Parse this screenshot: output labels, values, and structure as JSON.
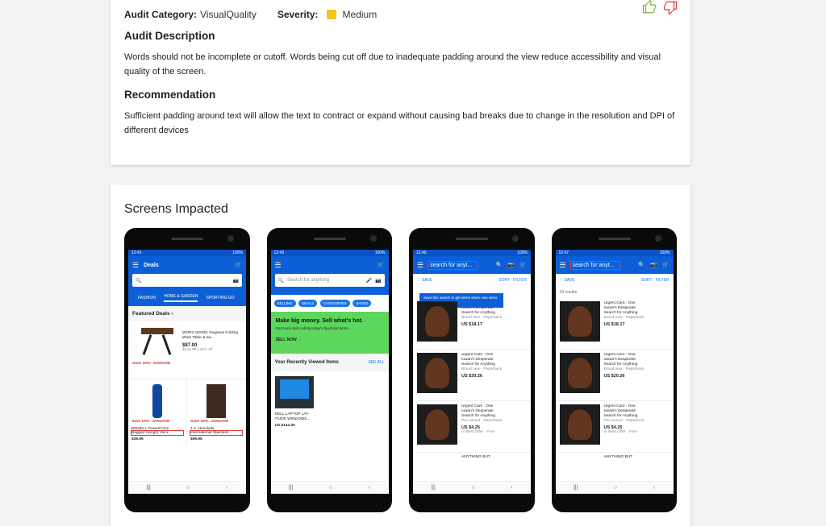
{
  "audit": {
    "category_label": "Audit Category:",
    "category_value": "VisualQuality",
    "severity_label": "Severity:",
    "severity_value": "Medium",
    "severity_color": "#f5c518",
    "description_heading": "Audit Description",
    "description_text": "Words should not be incomplete or cutoff. Words being cut off due to inadequate padding around the view reduce accessibility and visual quality of the screen.",
    "recommendation_heading": "Recommendation",
    "recommendation_text": "Sufficient padding around text will allow the text to contract or expand without causing bad breaks due to change in the resolution and DPI of different devices",
    "thumbs_up_color": "#7cb342",
    "thumbs_down_color": "#e53935"
  },
  "screens": {
    "heading": "Screens Impacted",
    "phone1": {
      "time": "12:41",
      "battery": "100%",
      "title": "Deals",
      "tabs": [
        "FASHION",
        "HOME & GARDEN",
        "SPORTING GO"
      ],
      "section": "Featured Deals",
      "item1_name": "WORX WX051 Pegasus Folding Work Table & Sa...",
      "item1_price": "$87.00",
      "item1_was": "$144.99 | 40% off",
      "item1_promo": "Save 15%: JANSAVE",
      "item2_promo": "Save 15%: JANSAVE",
      "item2_name1": "BISSELL PowerForce",
      "item2_name2": "Bagged Upright Vacu...",
      "item2_price": "$39.99",
      "item3_promo": "Save 15%: JANSAVE",
      "item3_name1": "J.A. Henckels",
      "item3_name2": "International Stainless...",
      "item3_price": "$99.95"
    },
    "phone2": {
      "time": "12:43",
      "battery": "100%",
      "search_placeholder": "Search for anything",
      "chips": [
        "SELLING",
        "DEALS",
        "CATEGORIES",
        "SAVED"
      ],
      "banner_heading": "Make big money. Sell what's hot.",
      "banner_sub": "Get more cash selling today's big-ticket items.",
      "banner_cta": "SELL NOW",
      "recent_heading": "Your Recently Viewed Items",
      "see_all": "SEE ALL",
      "item_name": "DELL LAPTOP LAT-ITUDE WINDOWS...",
      "item_price": "US $142.00"
    },
    "phone3": {
      "time": "12:46",
      "battery": "100%",
      "search_text": "search for anyt...",
      "save": "SAVE",
      "sort": "SORT",
      "filter": "FILTER",
      "tooltip": "Save this search to get alerts when new items arrive",
      "items": [
        {
          "l1": "Urgent Care : One",
          "l2": "Iowan's Desperate",
          "l3": "Search for Anything",
          "sub": "Brand new · Paperback",
          "price": "US $18.17",
          "extra": ""
        },
        {
          "l1": "Urgent Care : One",
          "l2": "Iowan's Desperate",
          "l3": "Search for Anything",
          "sub": "Brand new · Paperback",
          "price": "US $20.26",
          "extra": ""
        },
        {
          "l1": "Urgent Care : One",
          "l2": "Iowan's Desperate",
          "l3": "Search for Anything",
          "sub": "Pre-owned · Paperback",
          "price": "US $4.25",
          "extra": "or Best Offer · Free"
        }
      ],
      "last_item": "ANYTHING BUT"
    },
    "phone4": {
      "time": "12:47",
      "battery": "100%",
      "search_text": "search for anyt...",
      "save": "SAVE",
      "sort": "SORT",
      "filter": "FILTER",
      "results": "24 results",
      "items": [
        {
          "l1": "Urgent Care : One",
          "l2": "Iowan's Desperate",
          "l3": "Search for Anything",
          "sub": "Brand new · Paperback",
          "price": "US $18.17",
          "extra": ""
        },
        {
          "l1": "Urgent Care : One",
          "l2": "Iowan's Desperate",
          "l3": "Search for Anything",
          "sub": "Brand new · Paperback",
          "price": "US $20.26",
          "extra": ""
        },
        {
          "l1": "Urgent Care : One",
          "l2": "Iowan's Desperate",
          "l3": "Search for Anything",
          "sub": "Pre-owned · Paperback",
          "price": "US $4.25",
          "extra": "or Best Offer · Free"
        }
      ],
      "last_item": "ANYTHING BUT"
    }
  }
}
